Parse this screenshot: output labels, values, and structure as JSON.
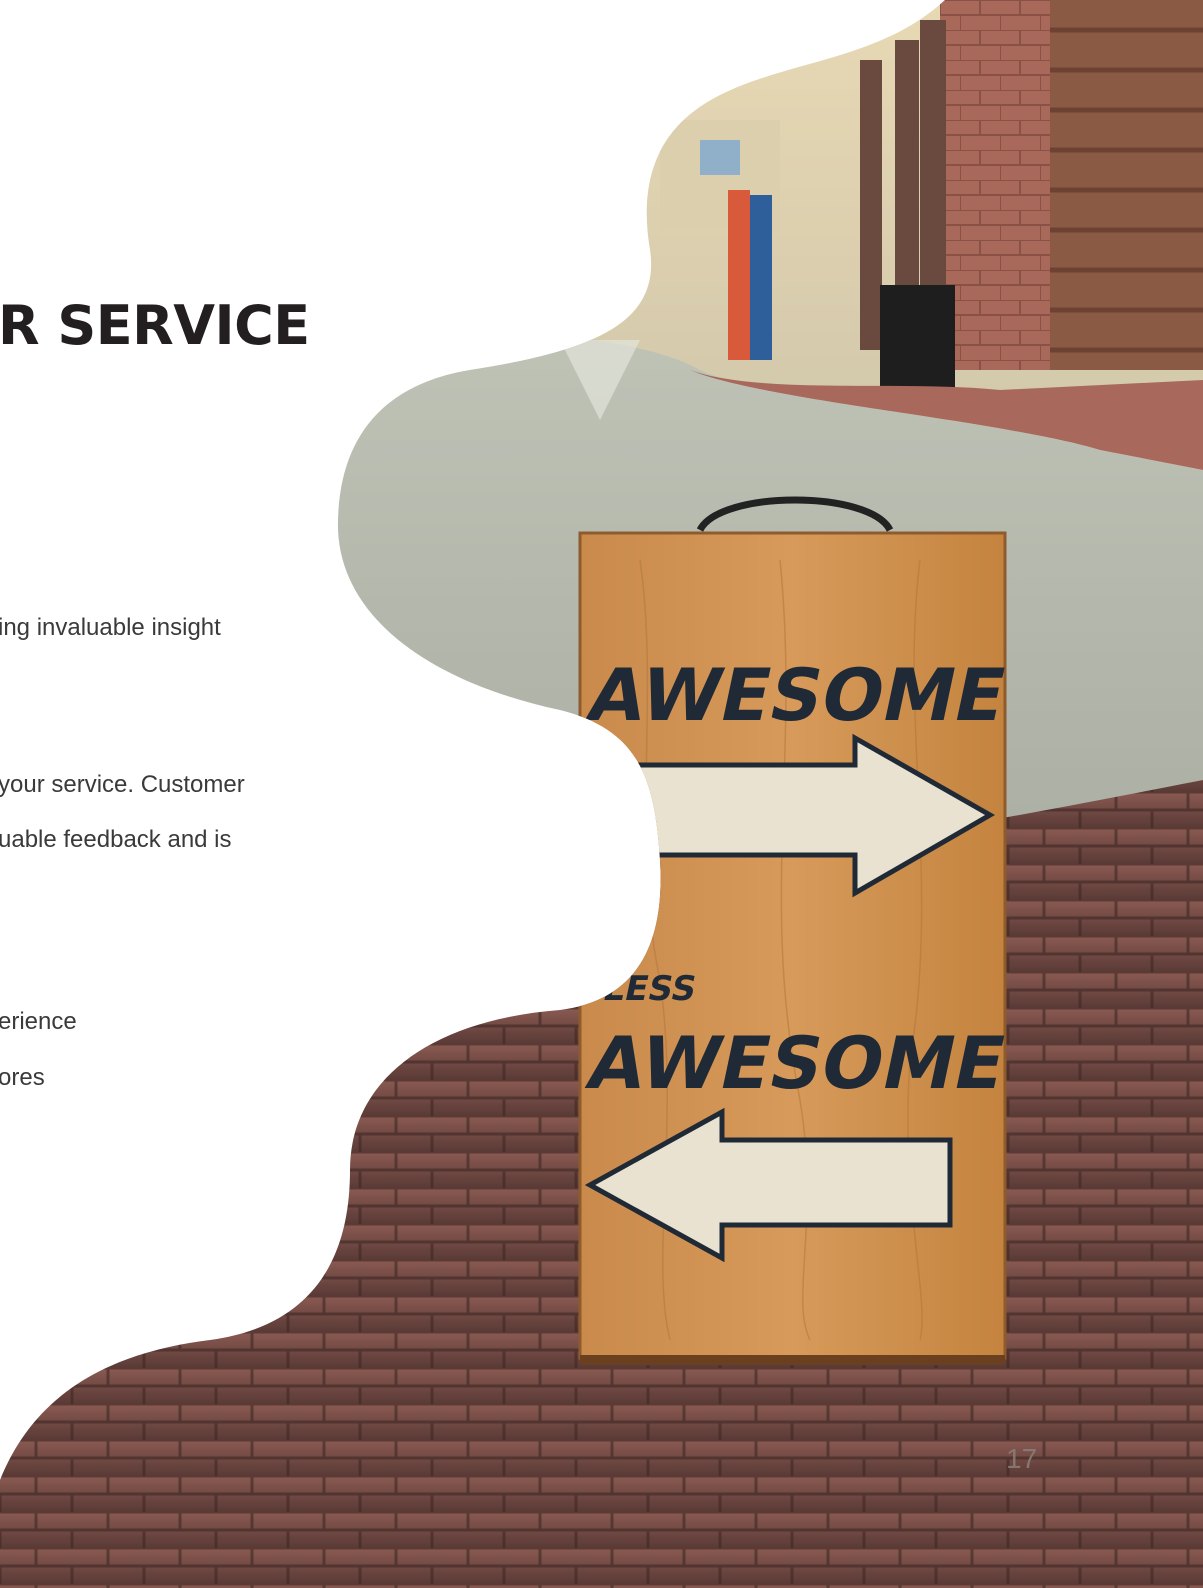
{
  "page": {
    "heading": "R SERVICE",
    "lines": [
      "ing invaluable insight",
      "your service. Customer",
      "uable feedback and is",
      "erience",
      "ores"
    ],
    "page_number": "17"
  },
  "photo": {
    "sign_top_text": "AWESOME",
    "sign_small_text": "LESS",
    "sign_bottom_text": "AWESOME"
  },
  "colors": {
    "heading": "#231f20",
    "body": "#3a3a3a",
    "sign_wood": "#c9894a",
    "sign_ink": "#1f2a36",
    "brick": "#7a5048"
  }
}
